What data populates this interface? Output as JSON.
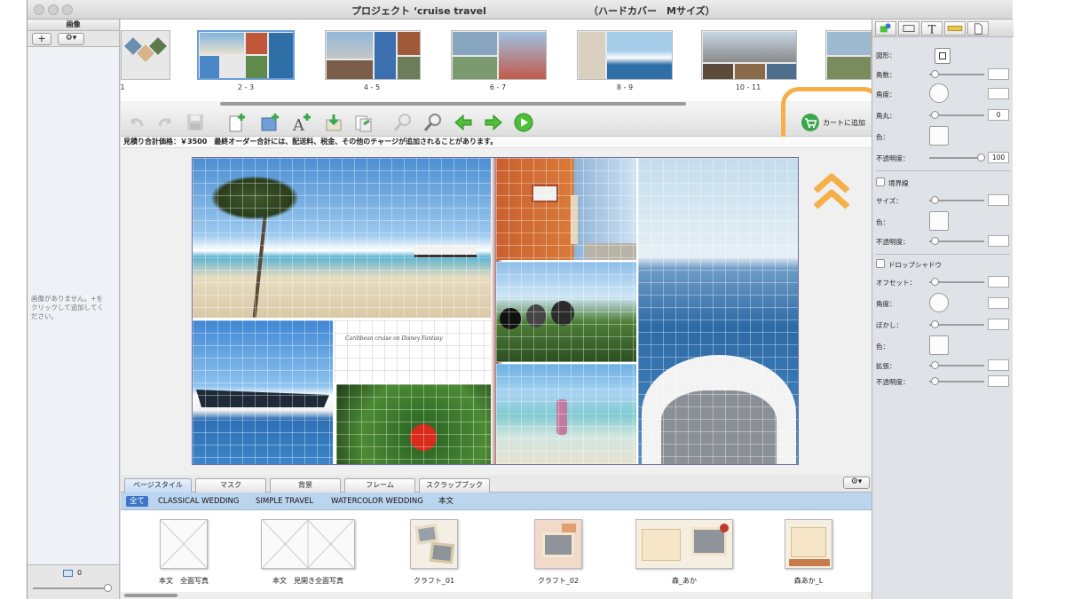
{
  "window": {
    "title_left": "プロジェクト ‘cruise travel",
    "title_right": "（ハードカバー　Mサイズ）"
  },
  "sidebar": {
    "header": "画像",
    "add_label": "+",
    "gear_label": "⚙▾",
    "empty_message": "画像がありません。+をクリックして追加してください。",
    "count": "0"
  },
  "page_strip": {
    "labels": [
      "1",
      "2 - 3",
      "4 - 5",
      "6 - 7",
      "8 - 9",
      "10 - 11"
    ],
    "selected": "2 - 3"
  },
  "toolbar": {
    "add_to_cart": "カートに追加"
  },
  "price_notice": "見積り合計価格：￥3500　最終オーダー合計には、配送料、税金、その他のチャージが追加されることがあります。",
  "spread": {
    "caption": "Caribbean cruise on Disney Fantasy"
  },
  "bottom_tabs": [
    "ページスタイル",
    "マスク",
    "背景",
    "フレーム",
    "スクラップブック"
  ],
  "filters": [
    "全て",
    "CLASSICAL WEDDING",
    "SIMPLE TRAVEL",
    "WATERCOLOR WEDDING",
    "本文"
  ],
  "styles": [
    "本文　全面写真",
    "本文　見開き全面写真",
    "クラフト_01",
    "クラフト_02",
    "森_あか",
    "森あか_L"
  ],
  "inspector": {
    "shape": "図形：",
    "corner": "角数：",
    "angle": "角度：",
    "corner_radius": "角丸：",
    "corner_radius_value": "0",
    "color": "色：",
    "opacity": "不透明度：",
    "opacity_value": "100",
    "border_title": "境界線",
    "border_size": "サイズ：",
    "border_color": "色：",
    "border_opacity": "不透明度：",
    "shadow_title": "ドロップシャドウ",
    "shadow_offset": "オフセット：",
    "shadow_angle": "角度：",
    "shadow_blur": "ぼかし：",
    "shadow_color": "色：",
    "shadow_spread": "拡張：",
    "shadow_opacity": "不透明度："
  },
  "colors": {
    "accent_orange": "#f5b04a",
    "cart_green": "#3aa84a",
    "arrow_green": "#4fbf38",
    "filter_blue": "#bcd5ef"
  }
}
